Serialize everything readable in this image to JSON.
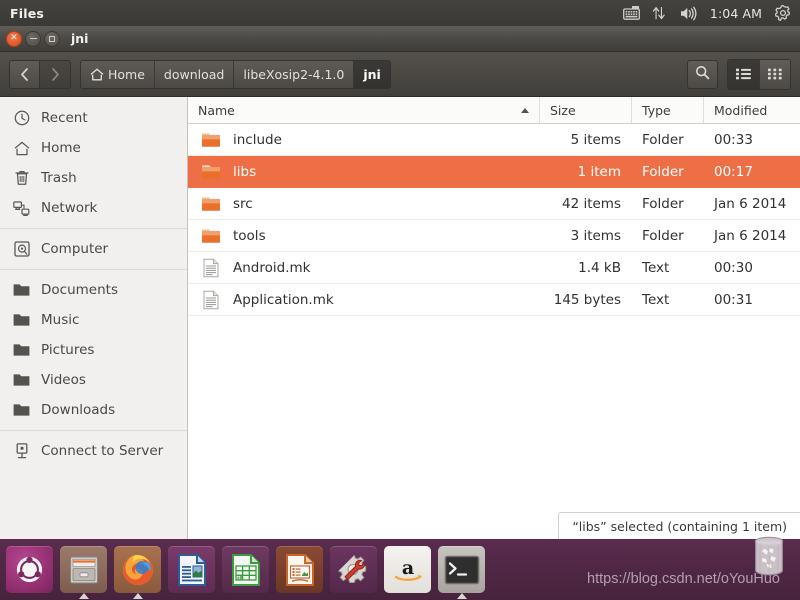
{
  "top_panel": {
    "app_name": "Files",
    "clock": "1:04 AM",
    "icons": [
      "keyboard-icon",
      "network-icon",
      "volume-icon",
      "system-menu-icon"
    ]
  },
  "window": {
    "title": "jni",
    "controls": {
      "close": "close-icon",
      "minimize": "minimize-icon",
      "maximize": "maximize-icon"
    }
  },
  "toolbar": {
    "back_label": "‹",
    "forward_label": "›",
    "breadcrumbs": [
      {
        "label": "Home",
        "icon": "home-icon",
        "active": false
      },
      {
        "label": "download",
        "icon": "",
        "active": false
      },
      {
        "label": "libeXosip2-4.1.0",
        "icon": "",
        "active": false
      },
      {
        "label": "jni",
        "icon": "",
        "active": true
      }
    ],
    "search_icon": "search-icon",
    "list_view_icon": "list-view-icon",
    "grid_view_icon": "grid-view-icon"
  },
  "sidebar": {
    "items": [
      {
        "label": "Recent",
        "icon": "clock-icon"
      },
      {
        "label": "Home",
        "icon": "home-icon"
      },
      {
        "label": "Trash",
        "icon": "trash-icon"
      },
      {
        "label": "Network",
        "icon": "network-icon"
      },
      {
        "separator": true
      },
      {
        "label": "Computer",
        "icon": "harddisk-icon"
      },
      {
        "separator": true
      },
      {
        "label": "Documents",
        "icon": "folder-icon"
      },
      {
        "label": "Music",
        "icon": "folder-icon"
      },
      {
        "label": "Pictures",
        "icon": "folder-icon"
      },
      {
        "label": "Videos",
        "icon": "folder-icon"
      },
      {
        "label": "Downloads",
        "icon": "folder-icon"
      },
      {
        "separator": true
      },
      {
        "label": "Connect to Server",
        "icon": "server-icon"
      }
    ]
  },
  "file_list": {
    "columns": [
      "Name",
      "Size",
      "Type",
      "Modified"
    ],
    "sort_column": "Name",
    "sort_direction": "ascending",
    "rows": [
      {
        "name": "include",
        "size": "5 items",
        "type": "Folder",
        "modified": "00:33",
        "icon": "folder-icon",
        "selected": false
      },
      {
        "name": "libs",
        "size": "1 item",
        "type": "Folder",
        "modified": "00:17",
        "icon": "folder-icon",
        "selected": true
      },
      {
        "name": "src",
        "size": "42 items",
        "type": "Folder",
        "modified": "Jan 6 2014",
        "icon": "folder-icon",
        "selected": false
      },
      {
        "name": "tools",
        "size": "3 items",
        "type": "Folder",
        "modified": "Jan 6 2014",
        "icon": "folder-icon",
        "selected": false
      },
      {
        "name": "Android.mk",
        "size": "1.4 kB",
        "type": "Text",
        "modified": "00:30",
        "icon": "text-file-icon",
        "selected": false
      },
      {
        "name": "Application.mk",
        "size": "145 bytes",
        "type": "Text",
        "modified": "00:31",
        "icon": "text-file-icon",
        "selected": false
      }
    ]
  },
  "status_bar": {
    "text": "“libs” selected  (containing 1 item)"
  },
  "dock": {
    "items": [
      {
        "name": "ubuntu-dash-icon",
        "label": "Dash Home",
        "running": false
      },
      {
        "name": "files-icon",
        "label": "Files",
        "running": true
      },
      {
        "name": "firefox-icon",
        "label": "Firefox",
        "running": true
      },
      {
        "name": "libreoffice-writer-icon",
        "label": "LibreOffice Writer",
        "running": false
      },
      {
        "name": "libreoffice-calc-icon",
        "label": "LibreOffice Calc",
        "running": false
      },
      {
        "name": "libreoffice-impress-icon",
        "label": "LibreOffice Impress",
        "running": false
      },
      {
        "name": "system-settings-icon",
        "label": "System Settings",
        "running": false
      },
      {
        "name": "amazon-icon",
        "label": "Amazon",
        "running": false
      },
      {
        "name": "terminal-icon",
        "label": "Terminal",
        "running": true
      }
    ],
    "trash_label": "Trash",
    "watermark": "https://blog.csdn.net/oYouHuo"
  },
  "colors": {
    "selection": "#ee6f46",
    "panel": "#3a3936",
    "titlebar": "#4b4945",
    "sidebar": "#f1f0ee",
    "dock": "#4f2744",
    "folder": "#e8702c"
  }
}
